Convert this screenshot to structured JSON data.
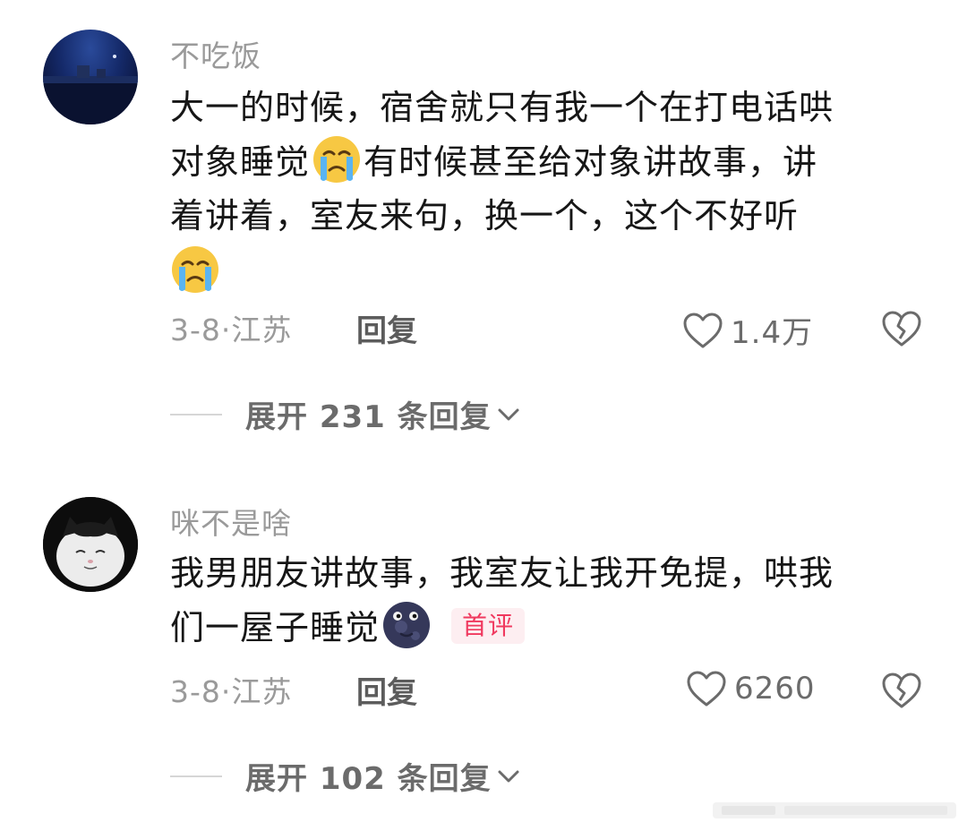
{
  "comments": [
    {
      "username": "不吃饭",
      "text_line1": "大一的时候，宿舍就只有我一个在打电话哄",
      "text_line2_a": "对象睡觉",
      "text_line2_b": "有时候甚至给对象讲故事，讲",
      "text_line3": "着讲着，室友来句，换一个，这个不好听",
      "meta": "3-8·江苏",
      "reply_label": "回复",
      "likes": "1.4万",
      "expand_label": "展开 231 条回复",
      "emoji": "crying-face"
    },
    {
      "username": "咪不是啥",
      "text_line1": "我男朋友讲故事，我室友让我开免提，哄我",
      "text_line2": "们一屋子睡觉",
      "badge": "首评",
      "meta": "3-8·江苏",
      "reply_label": "回复",
      "likes": "6260",
      "expand_label": "展开 102 条回复",
      "emoji": "new-moon-face"
    }
  ],
  "colors": {
    "username": "#9a9a9a",
    "text": "#161616",
    "badge_text": "#f0395f",
    "badge_bg": "#fdeef1",
    "icon": "#6b6b6b"
  }
}
